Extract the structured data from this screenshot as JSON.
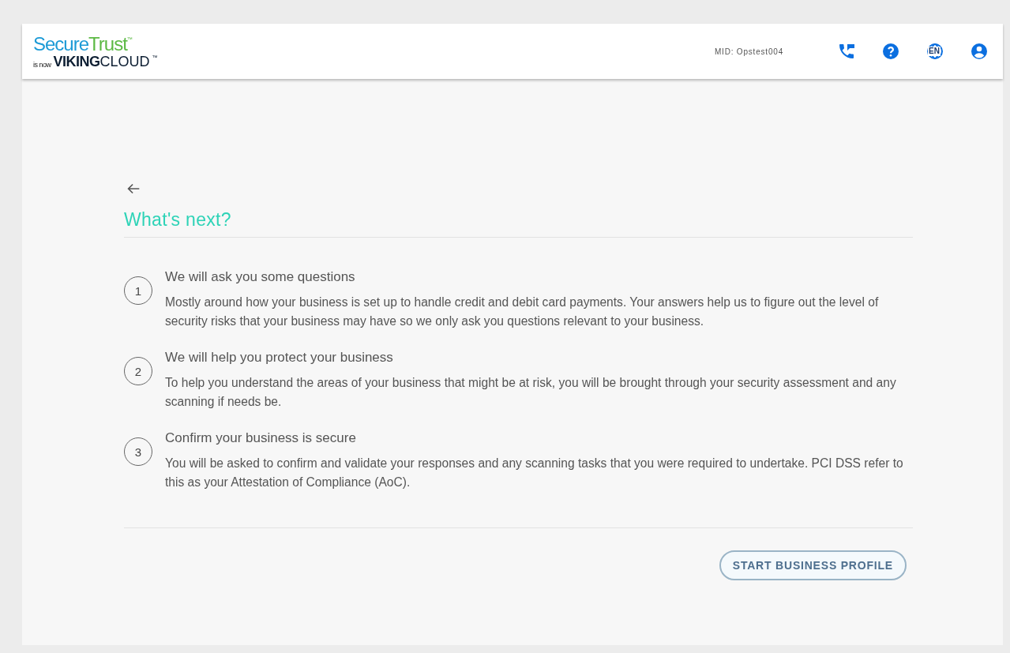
{
  "header": {
    "logo": {
      "brand_part_1": "Secure",
      "brand_part_2": "Trust",
      "brand_mark": "™",
      "tagline": "is now",
      "company_part_1": "VIKING",
      "company_part_2": "CLOUD",
      "company_mark": "™"
    },
    "mid": "MID: Opstest004",
    "language": "EN"
  },
  "page": {
    "title": "What's next?",
    "steps": [
      {
        "number": "1",
        "title": "We will ask you some questions",
        "text": "Mostly around how your business is set up to handle credit and debit card payments. Your answers help us to figure out the level of security risks that your business may have so we only ask you questions relevant to your business."
      },
      {
        "number": "2",
        "title": "We will help you protect your business",
        "text": "To help you understand the areas of your business that might be at risk, you will be brought through your security assessment and any scanning if needs be."
      },
      {
        "number": "3",
        "title": "Confirm your business is secure",
        "text": "You will be asked to confirm and validate your responses and any scanning tasks that you were required to undertake. PCI DSS refer to this as your Attestation of Compliance (AoC)."
      }
    ],
    "button": "START BUSINESS PROFILE"
  }
}
